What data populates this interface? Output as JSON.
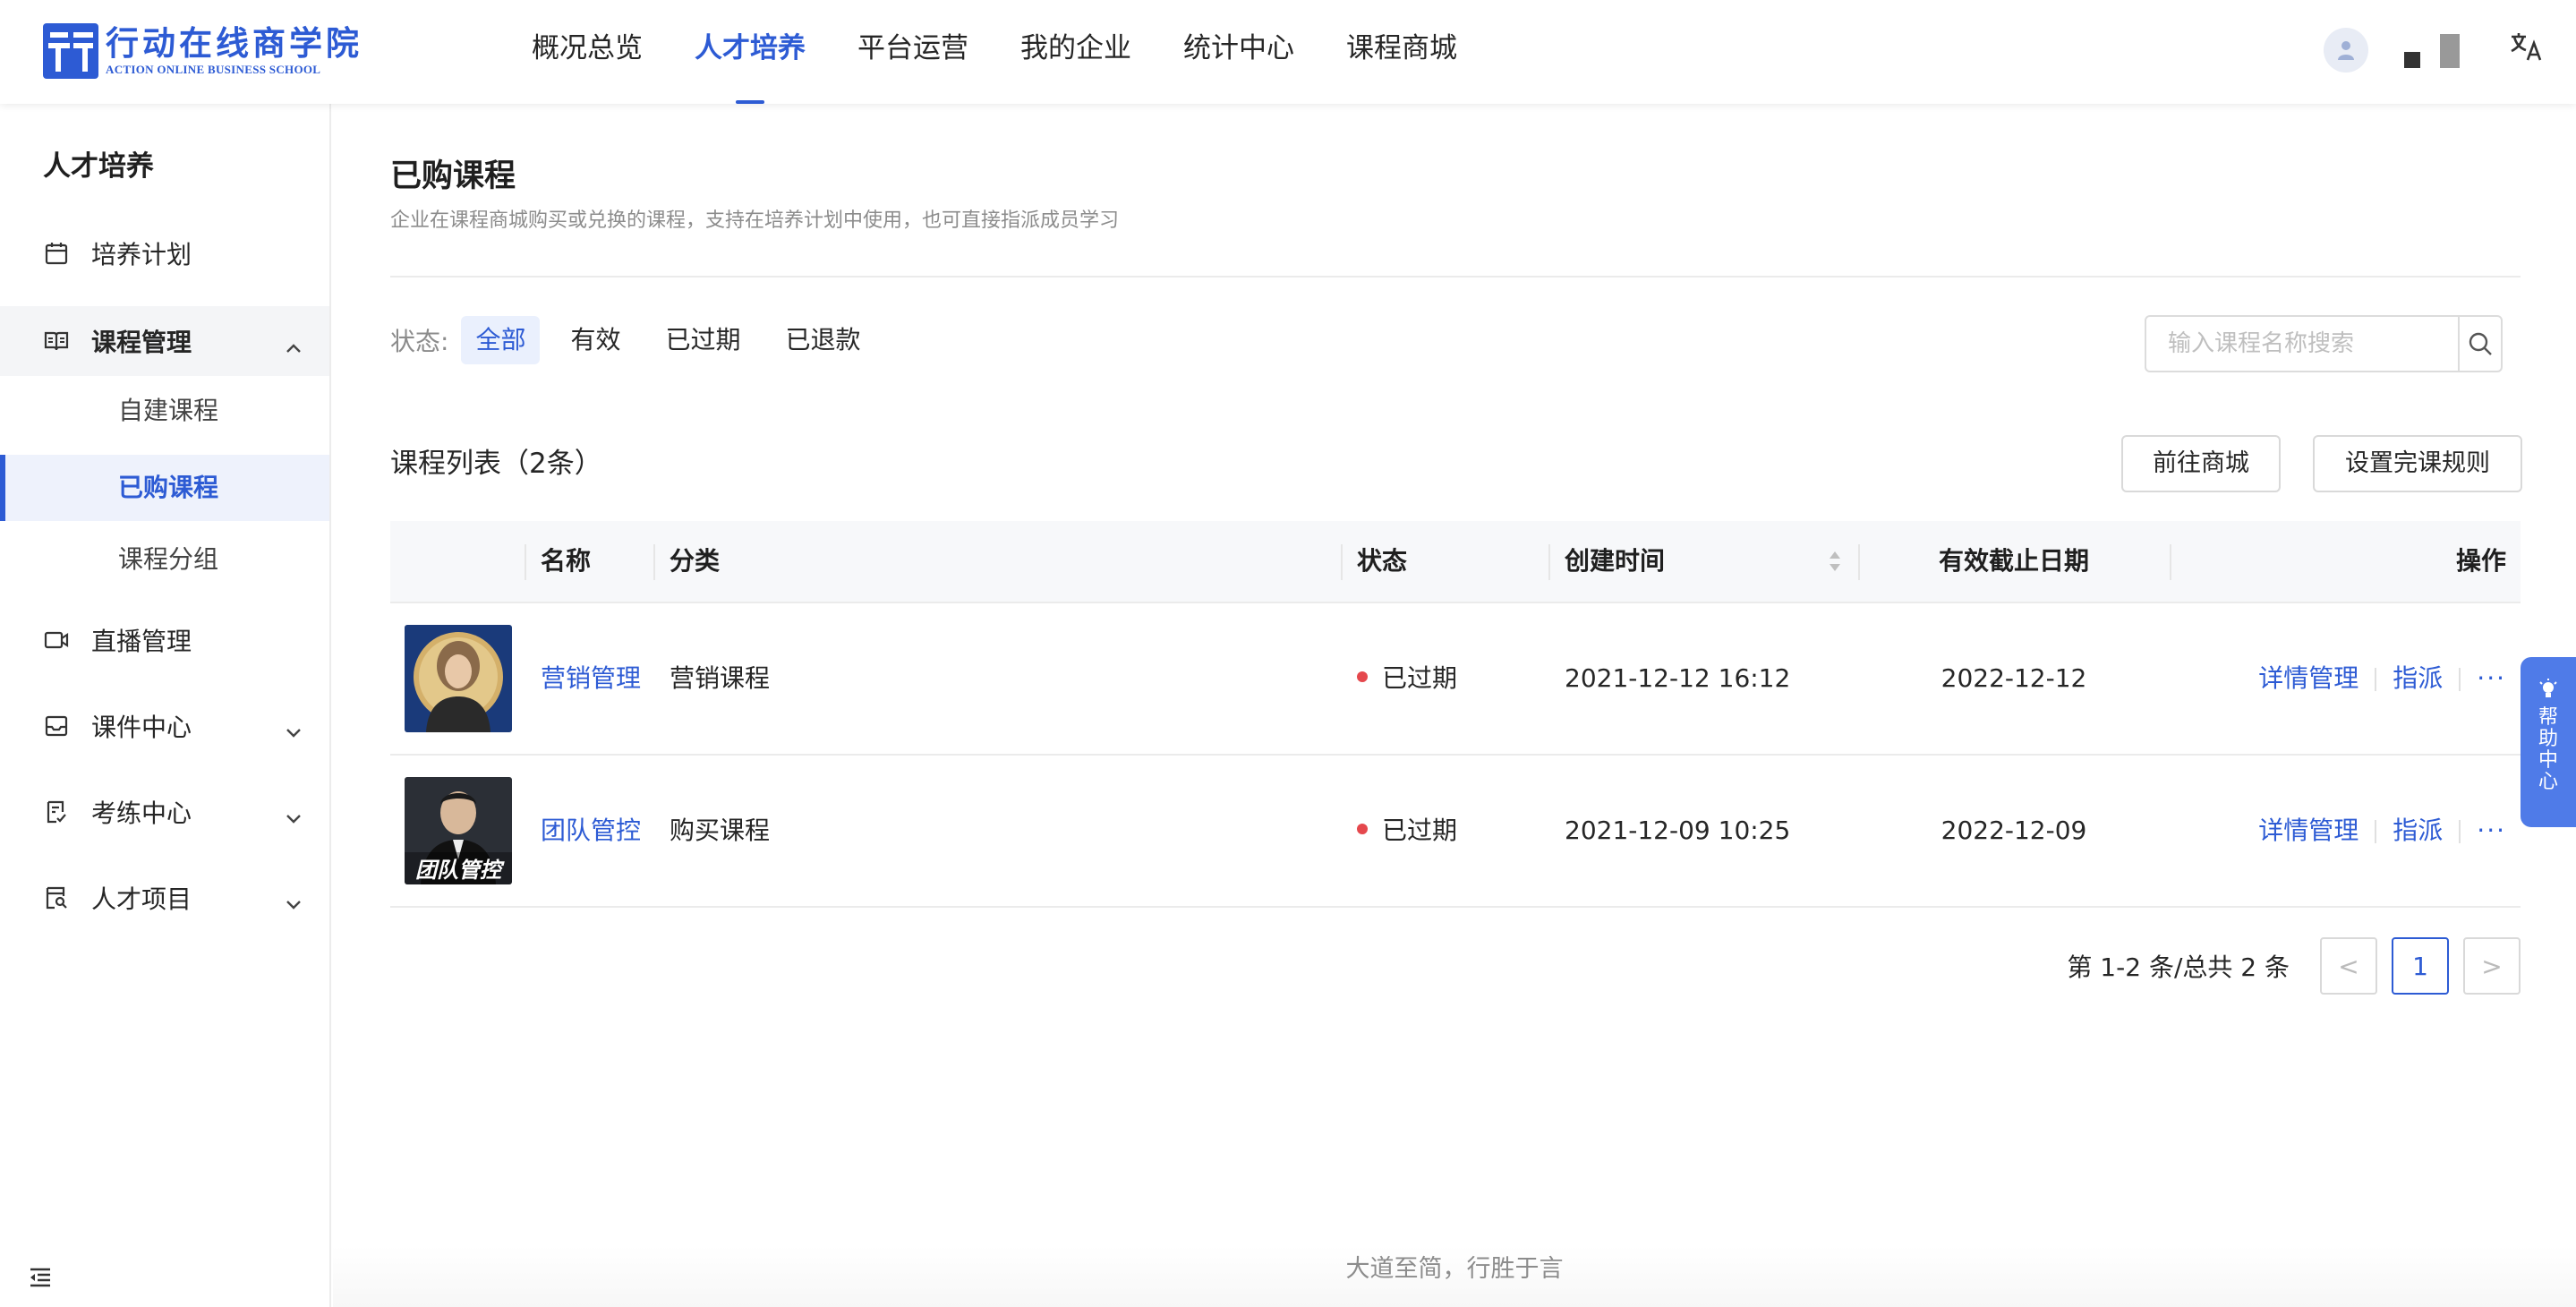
{
  "header": {
    "logo_cn": "行动在线商学院",
    "logo_en": "ACTION ONLINE BUSINESS SCHOOL",
    "nav": [
      {
        "label": "概况总览",
        "active": false
      },
      {
        "label": "人才培养",
        "active": true
      },
      {
        "label": "平台运营",
        "active": false
      },
      {
        "label": "我的企业",
        "active": false
      },
      {
        "label": "统计中心",
        "active": false
      },
      {
        "label": "课程商城",
        "active": false
      }
    ],
    "lang_icon": "文A"
  },
  "sidebar": {
    "title": "人才培养",
    "items": [
      {
        "label": "培养计划",
        "icon": "calendar-icon"
      },
      {
        "label": "课程管理",
        "icon": "book-icon",
        "expanded": true
      },
      {
        "label": "直播管理",
        "icon": "video-icon"
      },
      {
        "label": "课件中心",
        "icon": "inbox-icon"
      },
      {
        "label": "考练中心",
        "icon": "exam-icon"
      },
      {
        "label": "人才项目",
        "icon": "project-icon"
      }
    ],
    "sub_items": [
      {
        "label": "自建课程",
        "active": false
      },
      {
        "label": "已购课程",
        "active": true
      },
      {
        "label": "课程分组",
        "active": false
      }
    ]
  },
  "page": {
    "title": "已购课程",
    "description": "企业在课程商城购买或兑换的课程，支持在培养计划中使用，也可直接指派成员学习"
  },
  "filter": {
    "label": "状态:",
    "tabs": [
      {
        "label": "全部",
        "active": true
      },
      {
        "label": "有效",
        "active": false
      },
      {
        "label": "已过期",
        "active": false
      },
      {
        "label": "已退款",
        "active": false
      }
    ]
  },
  "search": {
    "placeholder": "输入课程名称搜索",
    "value": ""
  },
  "list": {
    "title": "课程列表（2条）",
    "goto_store": "前往商城",
    "set_rule": "设置完课规则"
  },
  "table": {
    "columns": [
      "名称",
      "分类",
      "状态",
      "创建时间",
      "有效截止日期",
      "操作"
    ],
    "rows": [
      {
        "name": "营销管理",
        "category": "营销课程",
        "status": "已过期",
        "created": "2021-12-12 16:12",
        "deadline": "2022-12-12",
        "action_detail": "详情管理",
        "action_assign": "指派",
        "action_more": "···"
      },
      {
        "name": "团队管控",
        "category": "购买课程",
        "status": "已过期",
        "created": "2021-12-09 10:25",
        "deadline": "2022-12-09",
        "action_detail": "详情管理",
        "action_assign": "指派",
        "action_more": "···",
        "thumb_text": "团队管控"
      }
    ],
    "status_color": "#e5484d"
  },
  "pagination": {
    "total_text": "第 1-2 条/总共 2 条",
    "prev": "<",
    "current": "1",
    "next": ">"
  },
  "footer": {
    "text": "大道至简，行胜于言"
  },
  "help": {
    "label": "帮助中心"
  },
  "colors": {
    "primary": "#2d5bd4",
    "help_bg": "#4f7be8"
  }
}
